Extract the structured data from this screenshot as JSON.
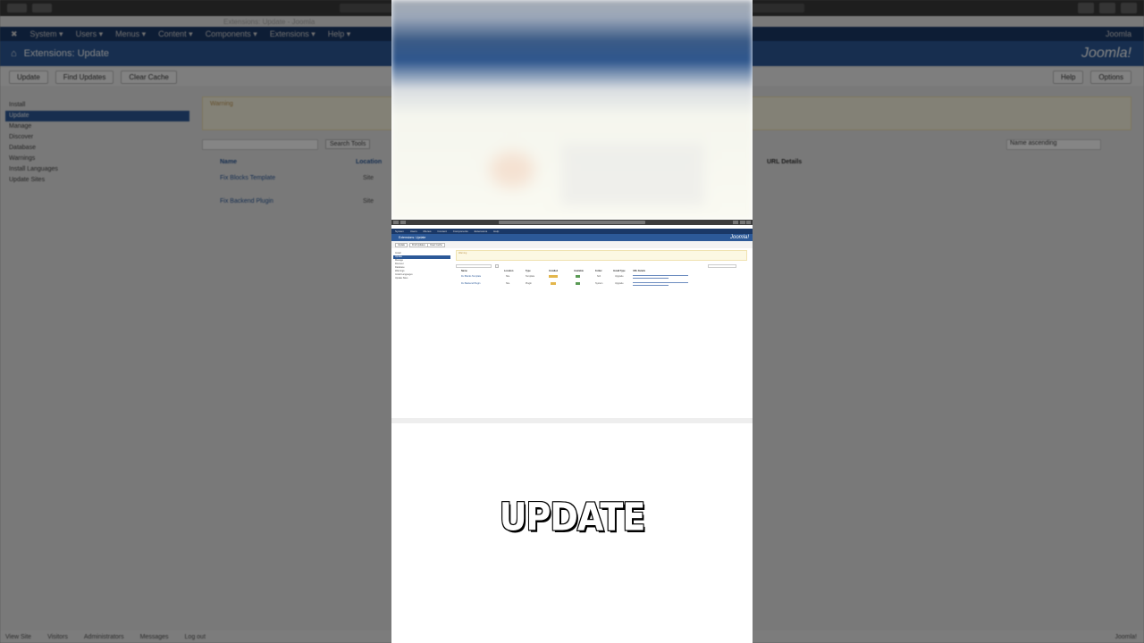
{
  "background": {
    "window_title": "Extensions: Update - Joomla",
    "nav": {
      "items": [
        "System ▾",
        "Users ▾",
        "Menus ▾",
        "Content ▾",
        "Components ▾",
        "Extensions ▾",
        "Help ▾"
      ],
      "right": "Joomla"
    },
    "page_title": "Extensions: Update",
    "brand": "Joomla!",
    "toolbar": {
      "update": "Update",
      "find_updates": "Find Updates",
      "clear_cache": "Clear Cache",
      "help": "Help",
      "options": "Options"
    },
    "sidebar": [
      "Install",
      "Update",
      "Manage",
      "Discover",
      "Database",
      "Warnings",
      "Install Languages",
      "Update Sites"
    ],
    "warning_title": "Warning",
    "search_placeholder": "Search",
    "search_tools": "Search Tools",
    "sort_label": "Name ascending",
    "table_headers": {
      "name": "Name",
      "location": "Location",
      "url_details": "URL Details"
    },
    "rows": [
      {
        "name": "Fix Blocks Template",
        "location": "Site"
      },
      {
        "name": "Fix Backend Plugin",
        "location": "Site"
      }
    ],
    "status": [
      "View Site",
      "Visitors",
      "Administrators",
      "Messages",
      "Log out"
    ],
    "footer": "Joomla!"
  },
  "mini": {
    "nav_items": [
      "System",
      "Users",
      "Menus",
      "Content",
      "Components",
      "Extensions",
      "Help"
    ],
    "page_title": "Extensions: Update",
    "brand": "Joomla!",
    "toolbar": [
      "Update",
      "Find Updates",
      "Clear Cache"
    ],
    "sidebar": [
      "Install",
      "Update",
      "Manage",
      "Discover",
      "Database",
      "Warnings",
      "Install Languages",
      "Update Sites"
    ],
    "warning": "Warning",
    "table_headers": [
      "Name",
      "Location",
      "Type",
      "Installed",
      "Available",
      "Folder",
      "Install Type",
      "URL Details"
    ],
    "rows": [
      {
        "name": "Fix Blocks Template",
        "location": "Site",
        "type": "Template",
        "folder": "N/A",
        "install_type": "Upgrade"
      },
      {
        "name": "Fix Backend Plugin",
        "location": "Site",
        "type": "Plugin",
        "folder": "System",
        "install_type": "Upgrade"
      }
    ]
  },
  "caption": "UPDATE",
  "colors": {
    "joomla_blue": "#2c5998",
    "navbar": "#1a3867",
    "warning_bg": "#fcf8e3",
    "badge_yellow": "#e3b64c",
    "badge_green": "#5a9a55"
  }
}
